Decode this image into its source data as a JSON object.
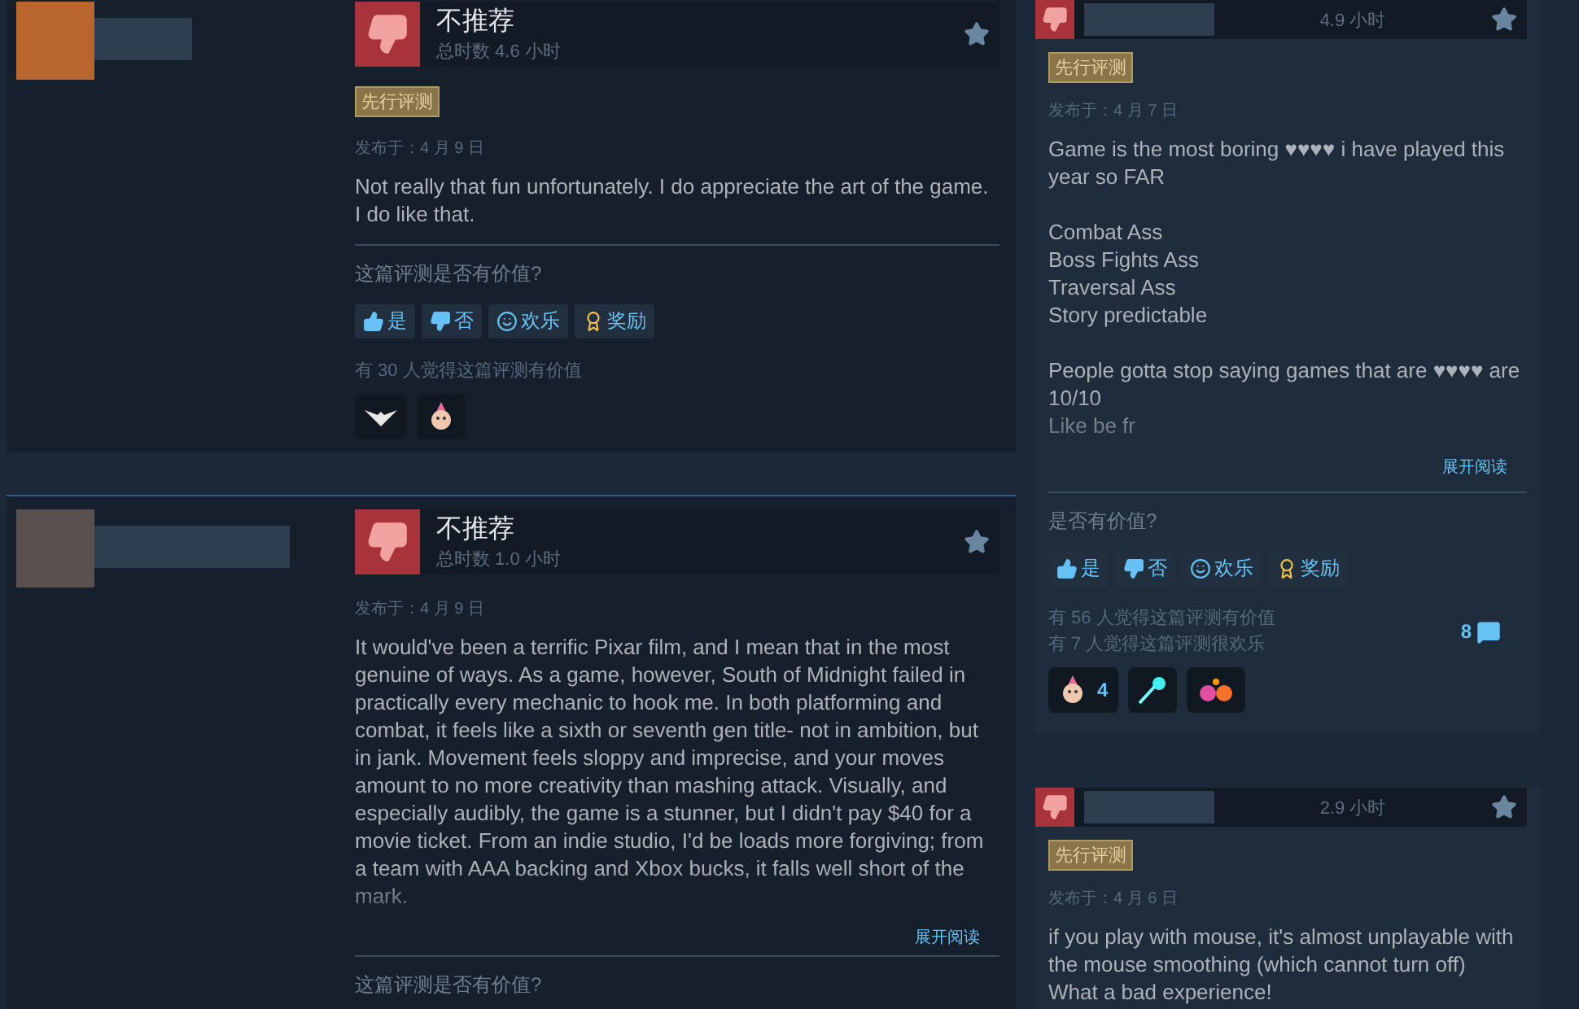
{
  "left_reviews": [
    {
      "recommendation": "不推荐",
      "playtime": "总时数 4.6 小时",
      "badge": "先行评测",
      "posted": "发布于：4 月 9 日",
      "body": "Not really that fun unfortunately. I do appreciate the art of the game. I do like that.",
      "helpful_prompt": "这篇评测是否有价值?",
      "buttons": [
        {
          "kind": "yes",
          "label": "是"
        },
        {
          "kind": "no",
          "label": "否"
        },
        {
          "kind": "funny",
          "label": "欢乐"
        },
        {
          "kind": "award",
          "label": "奖励"
        }
      ],
      "helpful_counts": [
        "有 30 人觉得这篇评测有价值"
      ],
      "awards": [
        {
          "kind": "wings"
        },
        {
          "kind": "face"
        }
      ]
    },
    {
      "recommendation": "不推荐",
      "playtime": "总时数 1.0 小时",
      "posted": "发布于：4 月 9 日",
      "body": "It would've been a terrific Pixar film, and I mean that in the most genuine of ways. As a game, however, South of Midnight failed in practically every mechanic to hook me. In both platforming and combat, it feels like a sixth or seventh gen title- not in ambition, but in jank. Movement feels sloppy and imprecise, and your moves amount to no more creativity than mashing attack. Visually, and especially audibly, the game is a stunner, but I didn't pay $40 for a movie ticket. From an indie studio, I'd be loads more forgiving; from a team with AAA backing and Xbox bucks, it falls well short of the mark.",
      "expand": "展开阅读",
      "helpful_prompt": "这篇评测是否有价值?"
    }
  ],
  "right_reviews": [
    {
      "playtime": "4.9 小时",
      "badge": "先行评测",
      "posted": "发布于：4 月 7 日",
      "body": "Game is the most boring ♥♥♥♥ i have played this year so FAR\n\nCombat Ass\nBoss Fights Ass\nTraversal Ass\nStory predictable\n\nPeople gotta stop saying games that are ♥♥♥♥ are 10/10\nLike be fr",
      "expand": "展开阅读",
      "helpful_prompt": "是否有价值?",
      "buttons": [
        {
          "kind": "yes",
          "label": "是"
        },
        {
          "kind": "no",
          "label": "否"
        },
        {
          "kind": "funny",
          "label": "欢乐"
        },
        {
          "kind": "award",
          "label": "奖励"
        }
      ],
      "helpful_counts": [
        "有 56 人觉得这篇评测有价值",
        "有 7 人觉得这篇评测很欢乐"
      ],
      "comment_count": "8",
      "awards": [
        {
          "kind": "face",
          "count": "4"
        },
        {
          "kind": "comet"
        },
        {
          "kind": "flowers"
        }
      ]
    },
    {
      "playtime": "2.9 小时",
      "badge": "先行评测",
      "posted": "发布于：4 月 6 日",
      "body": "if you play with mouse, it's almost unplayable with the mouse smoothing (which cannot turn off)\nWhat a bad experience!"
    }
  ]
}
